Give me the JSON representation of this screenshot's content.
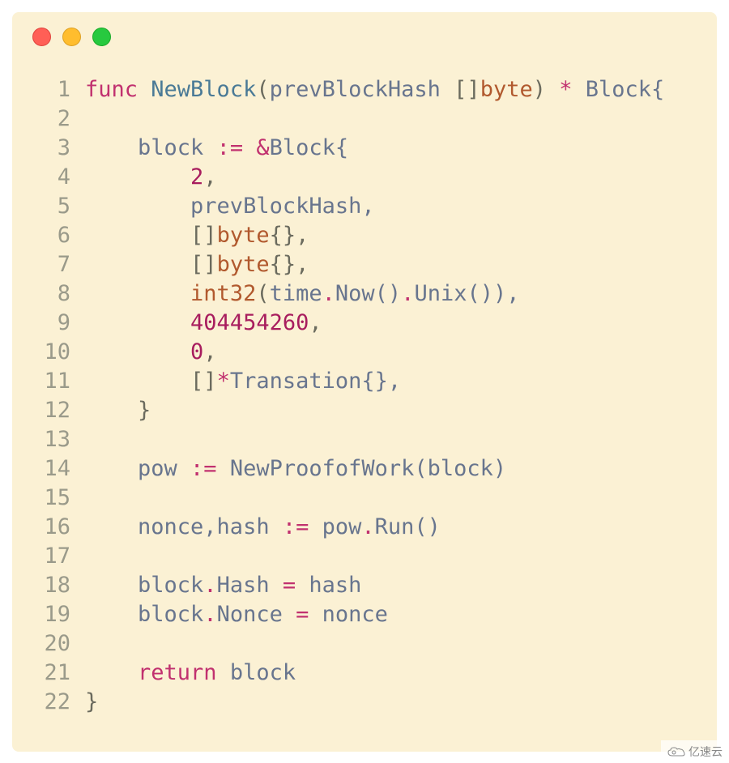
{
  "code": {
    "lines": [
      {
        "n": "1",
        "tokens": [
          {
            "t": "func ",
            "c": "tok-keyword"
          },
          {
            "t": "NewBlock",
            "c": "tok-func"
          },
          {
            "t": "(",
            "c": "tok-punct"
          },
          {
            "t": "prevBlockHash ",
            "c": "tok-ident"
          },
          {
            "t": "[]",
            "c": "tok-punct"
          },
          {
            "t": "byte",
            "c": "tok-type"
          },
          {
            "t": ") ",
            "c": "tok-punct"
          },
          {
            "t": "*",
            "c": "tok-keyword"
          },
          {
            "t": " Block{",
            "c": "tok-ident"
          }
        ]
      },
      {
        "n": "2",
        "tokens": []
      },
      {
        "n": "3",
        "tokens": [
          {
            "t": "    block ",
            "c": "tok-ident"
          },
          {
            "t": ":=",
            "c": "tok-keyword"
          },
          {
            "t": " ",
            "c": "tok-default"
          },
          {
            "t": "&",
            "c": "tok-keyword"
          },
          {
            "t": "Block{",
            "c": "tok-ident"
          }
        ]
      },
      {
        "n": "4",
        "tokens": [
          {
            "t": "        ",
            "c": "tok-default"
          },
          {
            "t": "2",
            "c": "tok-num"
          },
          {
            "t": ",",
            "c": "tok-punct"
          }
        ]
      },
      {
        "n": "5",
        "tokens": [
          {
            "t": "        prevBlockHash,",
            "c": "tok-ident"
          }
        ]
      },
      {
        "n": "6",
        "tokens": [
          {
            "t": "        []",
            "c": "tok-punct"
          },
          {
            "t": "byte",
            "c": "tok-type"
          },
          {
            "t": "{},",
            "c": "tok-punct"
          }
        ]
      },
      {
        "n": "7",
        "tokens": [
          {
            "t": "        []",
            "c": "tok-punct"
          },
          {
            "t": "byte",
            "c": "tok-type"
          },
          {
            "t": "{},",
            "c": "tok-punct"
          }
        ]
      },
      {
        "n": "8",
        "tokens": [
          {
            "t": "        ",
            "c": "tok-default"
          },
          {
            "t": "int32",
            "c": "tok-brown"
          },
          {
            "t": "(",
            "c": "tok-punct"
          },
          {
            "t": "time",
            "c": "tok-ident"
          },
          {
            "t": ".",
            "c": "tok-keyword"
          },
          {
            "t": "Now()",
            "c": "tok-ident"
          },
          {
            "t": ".",
            "c": "tok-keyword"
          },
          {
            "t": "Unix()),",
            "c": "tok-ident"
          }
        ]
      },
      {
        "n": "9",
        "tokens": [
          {
            "t": "        ",
            "c": "tok-default"
          },
          {
            "t": "404454260",
            "c": "tok-num"
          },
          {
            "t": ",",
            "c": "tok-punct"
          }
        ]
      },
      {
        "n": "10",
        "tokens": [
          {
            "t": "        ",
            "c": "tok-default"
          },
          {
            "t": "0",
            "c": "tok-num"
          },
          {
            "t": ",",
            "c": "tok-punct"
          }
        ]
      },
      {
        "n": "11",
        "tokens": [
          {
            "t": "        []",
            "c": "tok-punct"
          },
          {
            "t": "*",
            "c": "tok-keyword"
          },
          {
            "t": "Transation{},",
            "c": "tok-ident"
          }
        ]
      },
      {
        "n": "12",
        "tokens": [
          {
            "t": "    }",
            "c": "tok-punct"
          }
        ]
      },
      {
        "n": "13",
        "tokens": []
      },
      {
        "n": "14",
        "tokens": [
          {
            "t": "    pow ",
            "c": "tok-ident"
          },
          {
            "t": ":=",
            "c": "tok-keyword"
          },
          {
            "t": " NewProofofWork(block)",
            "c": "tok-ident"
          }
        ]
      },
      {
        "n": "15",
        "tokens": []
      },
      {
        "n": "16",
        "tokens": [
          {
            "t": "    nonce,hash ",
            "c": "tok-ident"
          },
          {
            "t": ":=",
            "c": "tok-keyword"
          },
          {
            "t": " pow",
            "c": "tok-ident"
          },
          {
            "t": ".",
            "c": "tok-keyword"
          },
          {
            "t": "Run()",
            "c": "tok-ident"
          }
        ]
      },
      {
        "n": "17",
        "tokens": []
      },
      {
        "n": "18",
        "tokens": [
          {
            "t": "    block",
            "c": "tok-ident"
          },
          {
            "t": ".",
            "c": "tok-keyword"
          },
          {
            "t": "Hash ",
            "c": "tok-ident"
          },
          {
            "t": "=",
            "c": "tok-keyword"
          },
          {
            "t": " hash",
            "c": "tok-ident"
          }
        ]
      },
      {
        "n": "19",
        "tokens": [
          {
            "t": "    block",
            "c": "tok-ident"
          },
          {
            "t": ".",
            "c": "tok-keyword"
          },
          {
            "t": "Nonce ",
            "c": "tok-ident"
          },
          {
            "t": "=",
            "c": "tok-keyword"
          },
          {
            "t": " nonce",
            "c": "tok-ident"
          }
        ]
      },
      {
        "n": "20",
        "tokens": []
      },
      {
        "n": "21",
        "tokens": [
          {
            "t": "    ",
            "c": "tok-default"
          },
          {
            "t": "return",
            "c": "tok-keyword"
          },
          {
            "t": " block",
            "c": "tok-ident"
          }
        ]
      },
      {
        "n": "22",
        "tokens": [
          {
            "t": "}",
            "c": "tok-punct"
          }
        ]
      }
    ]
  },
  "watermark": {
    "text": "亿速云",
    "icon": "cloud-icon"
  }
}
